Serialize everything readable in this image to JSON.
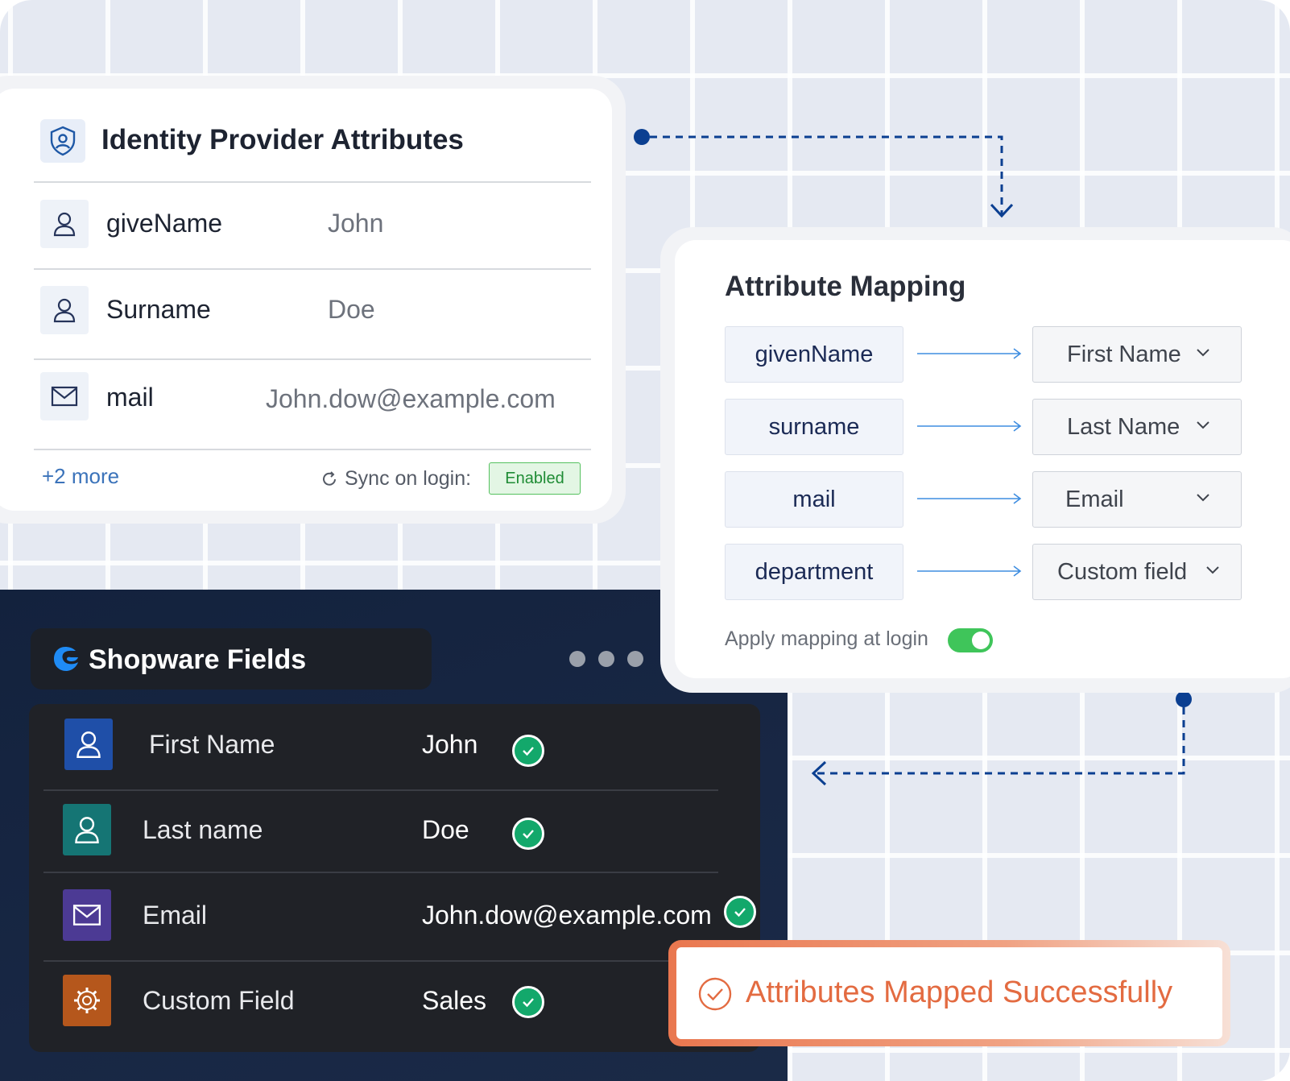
{
  "idp": {
    "title": "Identity Provider Attributes",
    "rows": [
      {
        "key": "giveName",
        "value": "John",
        "icon": "user-icon"
      },
      {
        "key": "Surname",
        "value": "Doe",
        "icon": "user-icon"
      },
      {
        "key": "mail",
        "value": "John.dow@example.com",
        "icon": "mail-icon"
      }
    ],
    "more": "+2 more",
    "sync_label": "Sync on login:",
    "sync_status": "Enabled"
  },
  "mapping": {
    "title": "Attribute Mapping",
    "rows": [
      {
        "source": "givenName",
        "target": "First Name"
      },
      {
        "source": "surname",
        "target": "Last Name"
      },
      {
        "source": "mail",
        "target": "Email"
      },
      {
        "source": "department",
        "target": "Custom field"
      }
    ],
    "apply_label": "Apply mapping at login",
    "apply_enabled": true
  },
  "shopware": {
    "title": "Shopware Fields",
    "rows": [
      {
        "key": "First Name",
        "value": "John",
        "icon": "user-icon",
        "color": "#1f4fa8"
      },
      {
        "key": "Last name",
        "value": "Doe",
        "icon": "user-icon",
        "color": "#157574"
      },
      {
        "key": "Email",
        "value": "John.dow@example.com",
        "icon": "mail-icon",
        "color": "#4c3a94"
      },
      {
        "key": "Custom Field",
        "value": "Sales",
        "icon": "gear-icon",
        "color": "#b5571c"
      }
    ]
  },
  "success": {
    "message": "Attributes Mapped Successfully",
    "color": "#e36b41"
  },
  "colors": {
    "accent": "#0b3f91",
    "success_check": "#13a86b",
    "toggle_on": "#3fc55a"
  }
}
